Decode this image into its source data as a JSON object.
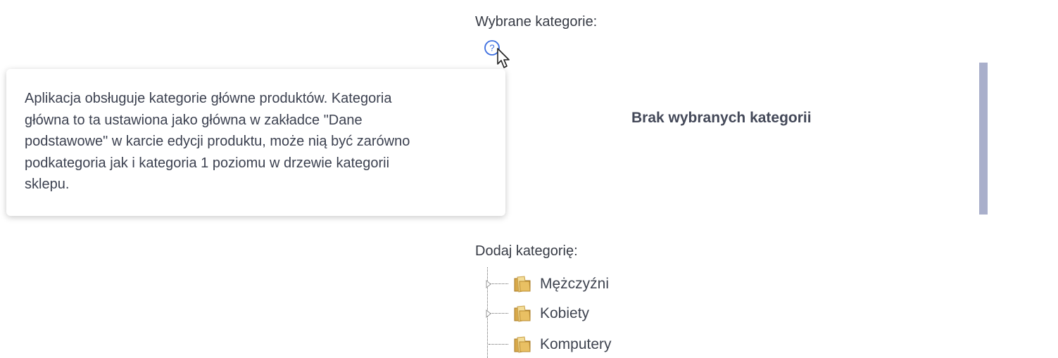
{
  "selected_categories": {
    "label": "Wybrane kategorie:",
    "help_icon": "question-circle-icon",
    "empty_message": "Brak wybranych kategorii"
  },
  "tooltip": {
    "text": "Aplikacja obsługuje kategorie główne produktów. Kategoria główna to ta ustawiona jako główna w zakładce \"Dane podstawowe\" w karcie edycji produktu, może nią być zarówno podkategoria jak i kategoria 1 poziomu w drzewie kategorii sklepu.",
    "lines": [
      "Aplikacja obsługuje kategorie główne produktów. Kategoria",
      "główna to ta ustawiona jako główna w zakładce \"Dane",
      "podstawowe\" w karcie edycji produktu, może nią być zarówno",
      "podkategoria jak i kategoria 1 poziomu w drzewie kategorii",
      "sklepu."
    ]
  },
  "add_category": {
    "label": "Dodaj kategorię:",
    "tree": [
      {
        "label": "Mężczyźni",
        "icon": "folder-icon",
        "expandable": true
      },
      {
        "label": "Kobiety",
        "icon": "folder-icon",
        "expandable": true
      },
      {
        "label": "Komputery",
        "icon": "folder-icon",
        "expandable": false
      }
    ]
  },
  "colors": {
    "accent": "#3d6fe0",
    "right_bar": "#a9afcb",
    "text": "#3c4150"
  }
}
